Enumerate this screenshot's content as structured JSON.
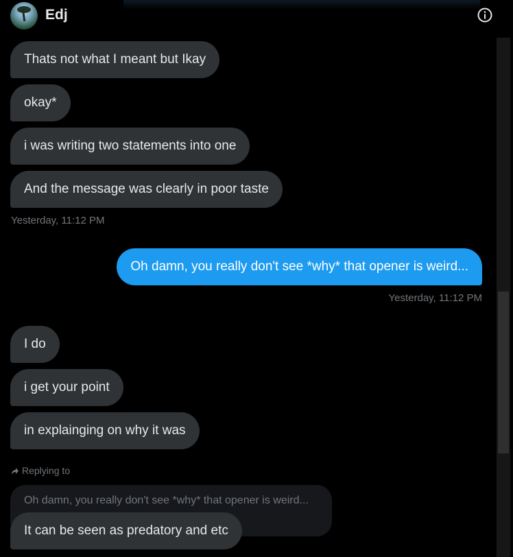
{
  "header": {
    "name": "Edj",
    "avatar_icon": "profile-photo",
    "info_icon": "info-icon"
  },
  "messages": [
    {
      "direction": "incoming",
      "text": "Thats not what I meant but Ikay"
    },
    {
      "direction": "incoming",
      "text": "okay*"
    },
    {
      "direction": "incoming",
      "text": "i was writing two statements into one"
    },
    {
      "direction": "incoming",
      "text": "And the message was clearly in poor taste"
    },
    {
      "direction": "incoming",
      "timestamp": "Yesterday, 11:12 PM"
    },
    {
      "direction": "outgoing",
      "text": "Oh damn, you really don't see *why* that opener is weird..."
    },
    {
      "direction": "outgoing",
      "timestamp": "Yesterday, 11:12 PM"
    },
    {
      "direction": "incoming",
      "text": "I do"
    },
    {
      "direction": "incoming",
      "text": "i get your point"
    },
    {
      "direction": "incoming",
      "text": "in explainging on why it was"
    },
    {
      "direction": "incoming",
      "text": "It can be seen as predatory and etc"
    }
  ],
  "reply": {
    "label": "Replying to",
    "quoted_text": "Oh damn, you really don't see *why* that opener is weird..."
  },
  "colors": {
    "background": "#000000",
    "incoming_bubble": "#2f3336",
    "outgoing_bubble": "#1d9bf0",
    "muted_text": "#71767b"
  }
}
